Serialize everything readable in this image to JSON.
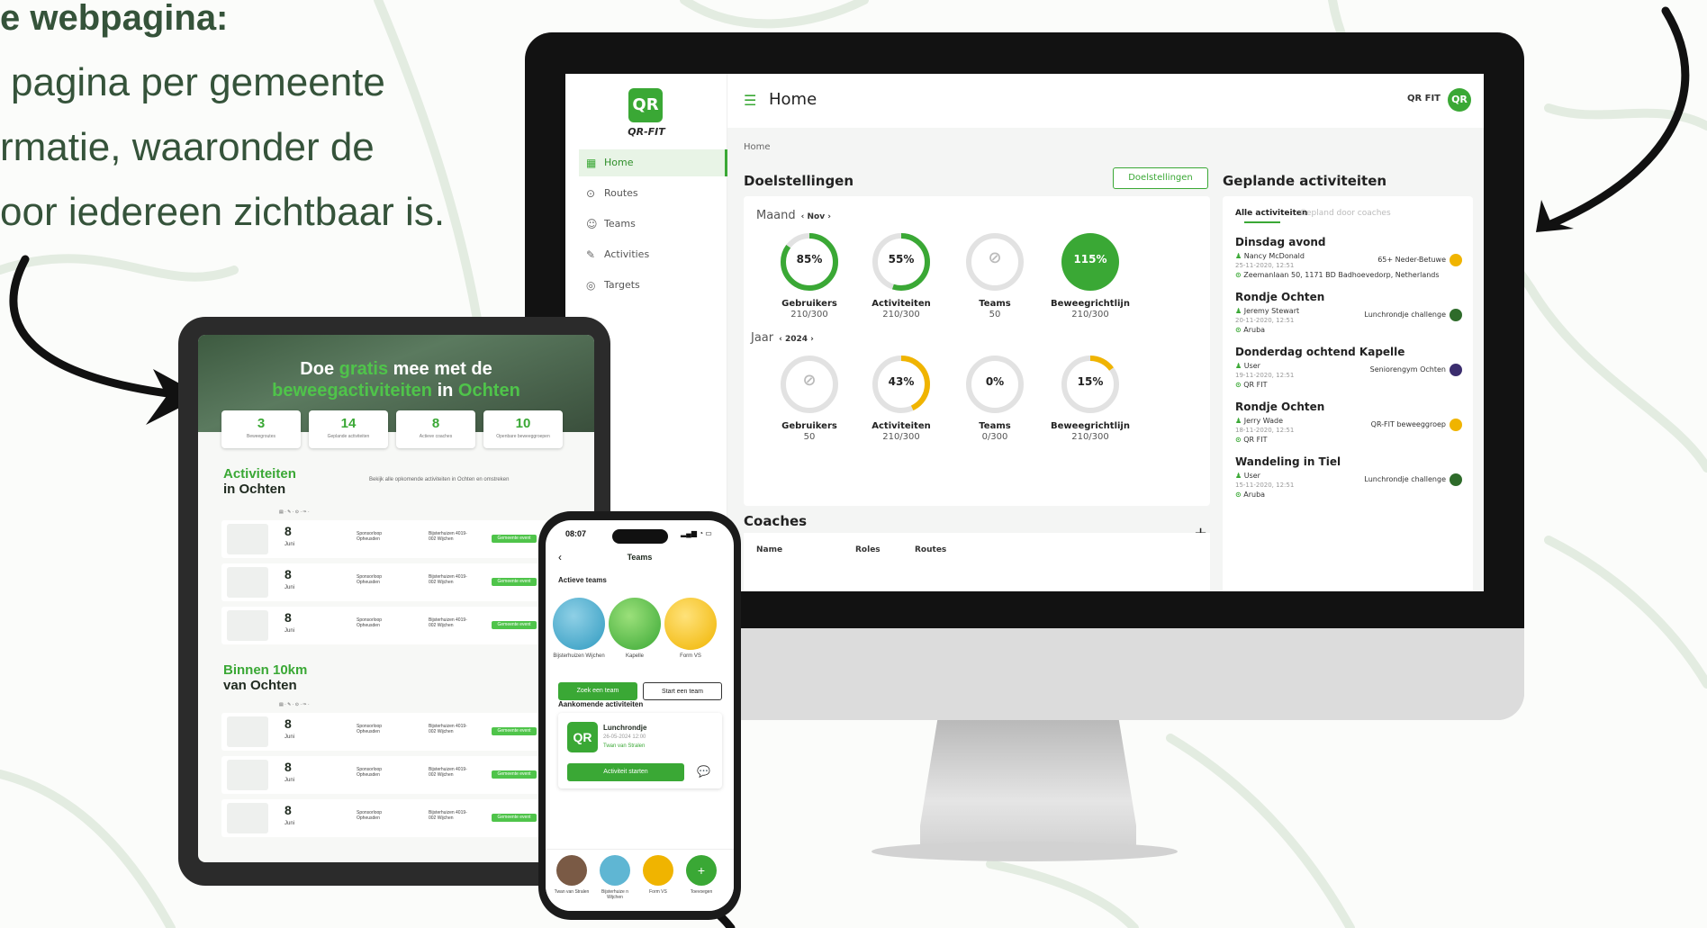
{
  "headline": {
    "title": "e webpagina:",
    "line1": "pagina per gemeente",
    "line2": "rmatie, waaronder de",
    "line3": "oor iedereen zichtbaar is."
  },
  "app": {
    "logo_text": "QR-FIT",
    "nav": [
      "Home",
      "Routes",
      "Teams",
      "Activities",
      "Targets"
    ],
    "page_title": "Home",
    "user_label": "QR FIT",
    "breadcrumb": "Home",
    "goals_title": "Doelstellingen",
    "goals_button": "Doelstellingen",
    "month_label": "Maand",
    "month_value": "Nov",
    "year_label": "Jaar",
    "year_value": "2024",
    "month_rings": [
      {
        "value": "85%",
        "pct": 0.85,
        "color": "#3aa835",
        "label": "Gebruikers",
        "sub": "210/300"
      },
      {
        "value": "55%",
        "pct": 0.55,
        "color": "#3aa835",
        "label": "Activiteiten",
        "sub": "210/300"
      },
      {
        "value": "",
        "pct": 0,
        "color": "#3aa835",
        "label": "Teams",
        "sub": "50"
      },
      {
        "value": "115%",
        "pct": 1.0,
        "color": "#3aa835",
        "label": "Beweegrichtlijn",
        "sub": "210/300"
      }
    ],
    "year_rings": [
      {
        "value": "",
        "pct": 0,
        "color": "#f0b400",
        "label": "Gebruikers",
        "sub": "50"
      },
      {
        "value": "43%",
        "pct": 0.43,
        "color": "#f0b400",
        "label": "Activiteiten",
        "sub": "210/300"
      },
      {
        "value": "0%",
        "pct": 0,
        "color": "#f0b400",
        "label": "Teams",
        "sub": "0/300"
      },
      {
        "value": "15%",
        "pct": 0.15,
        "color": "#f0b400",
        "label": "Beweegrichtlijn",
        "sub": "210/300"
      }
    ],
    "coaches_title": "Coaches",
    "coach_headers": [
      "Name",
      "Roles",
      "Routes"
    ],
    "planned_title": "Geplande activiteiten",
    "tab_all": "Alle activiteiten",
    "tab_coach": "Gepland door coaches",
    "activities": [
      {
        "title": "Dinsdag avond",
        "user": "Nancy McDonald",
        "date": "25-11-2020, 12:51",
        "loc": "Zeemanlaan 50, 1171 BD Badhoevedorp, Netherlands",
        "group": "65+ Neder-Betuwe",
        "dot": "#f0b400"
      },
      {
        "title": "Rondje Ochten",
        "user": "Jeremy Stewart",
        "date": "20-11-2020, 12:51",
        "loc": "Aruba",
        "group": "Lunchrondje challenge",
        "dot": "#2e6b2a"
      },
      {
        "title": "Donderdag ochtend Kapelle",
        "user": "User",
        "date": "19-11-2020, 12:51",
        "loc": "QR FIT",
        "group": "Seniorengym Ochten",
        "dot": "#3b2d6e"
      },
      {
        "title": "Rondje Ochten",
        "user": "Jerry Wade",
        "date": "18-11-2020, 12:51",
        "loc": "QR FIT",
        "group": "QR-FIT beweeggroep",
        "dot": "#f0b400"
      },
      {
        "title": "Wandeling in Tiel",
        "user": "User",
        "date": "15-11-2020, 12:51",
        "loc": "Aruba",
        "group": "Lunchrondje challenge",
        "dot": "#2e6b2a"
      }
    ]
  },
  "tablet": {
    "hero_a": "Doe ",
    "hero_b": "gratis",
    "hero_c": " mee met de",
    "hero_d": "beweegactiviteiten",
    "hero_e": " in ",
    "hero_f": "Ochten",
    "stats": [
      {
        "value": "3",
        "label": "Beweegroutes"
      },
      {
        "value": "14",
        "label": "Geplande activiteiten"
      },
      {
        "value": "8",
        "label": "Actieve coaches"
      },
      {
        "value": "10",
        "label": "Openbare beweeggroepen"
      }
    ],
    "sec1_a": "Activiteiten",
    "sec1_b": "in Ochten",
    "sec1_desc": "Bekijk alle opkomende activiteiten in Ochten en omstreken",
    "sec2_a": "Binnen 10km",
    "sec2_b": "van Ochten",
    "row": {
      "day": "8",
      "mon": "Juni",
      "org": "Sponsorloop Opheusden",
      "adr": "Bijsterhuizen 4019-002 Wijchen",
      "tag": "Gemeente event"
    }
  },
  "phone": {
    "time": "08:07",
    "title": "Teams",
    "active_label": "Actieve teams",
    "teams": [
      "Bijsterhuizen Wijchen",
      "Kapelle",
      "Form VS"
    ],
    "btn_find": "Zoek een team",
    "btn_start": "Start een team",
    "upcoming_label": "Aankomende activiteiten",
    "card_title": "Lunchrondje",
    "card_date": "26-05-2024 12:00",
    "card_user": "Twan van Stralen",
    "card_button": "Activiteit starten",
    "nav": [
      "Twan van Stralen",
      "Bijsterhuize n Wijchen",
      "Form VS",
      "Toevoegen"
    ]
  }
}
